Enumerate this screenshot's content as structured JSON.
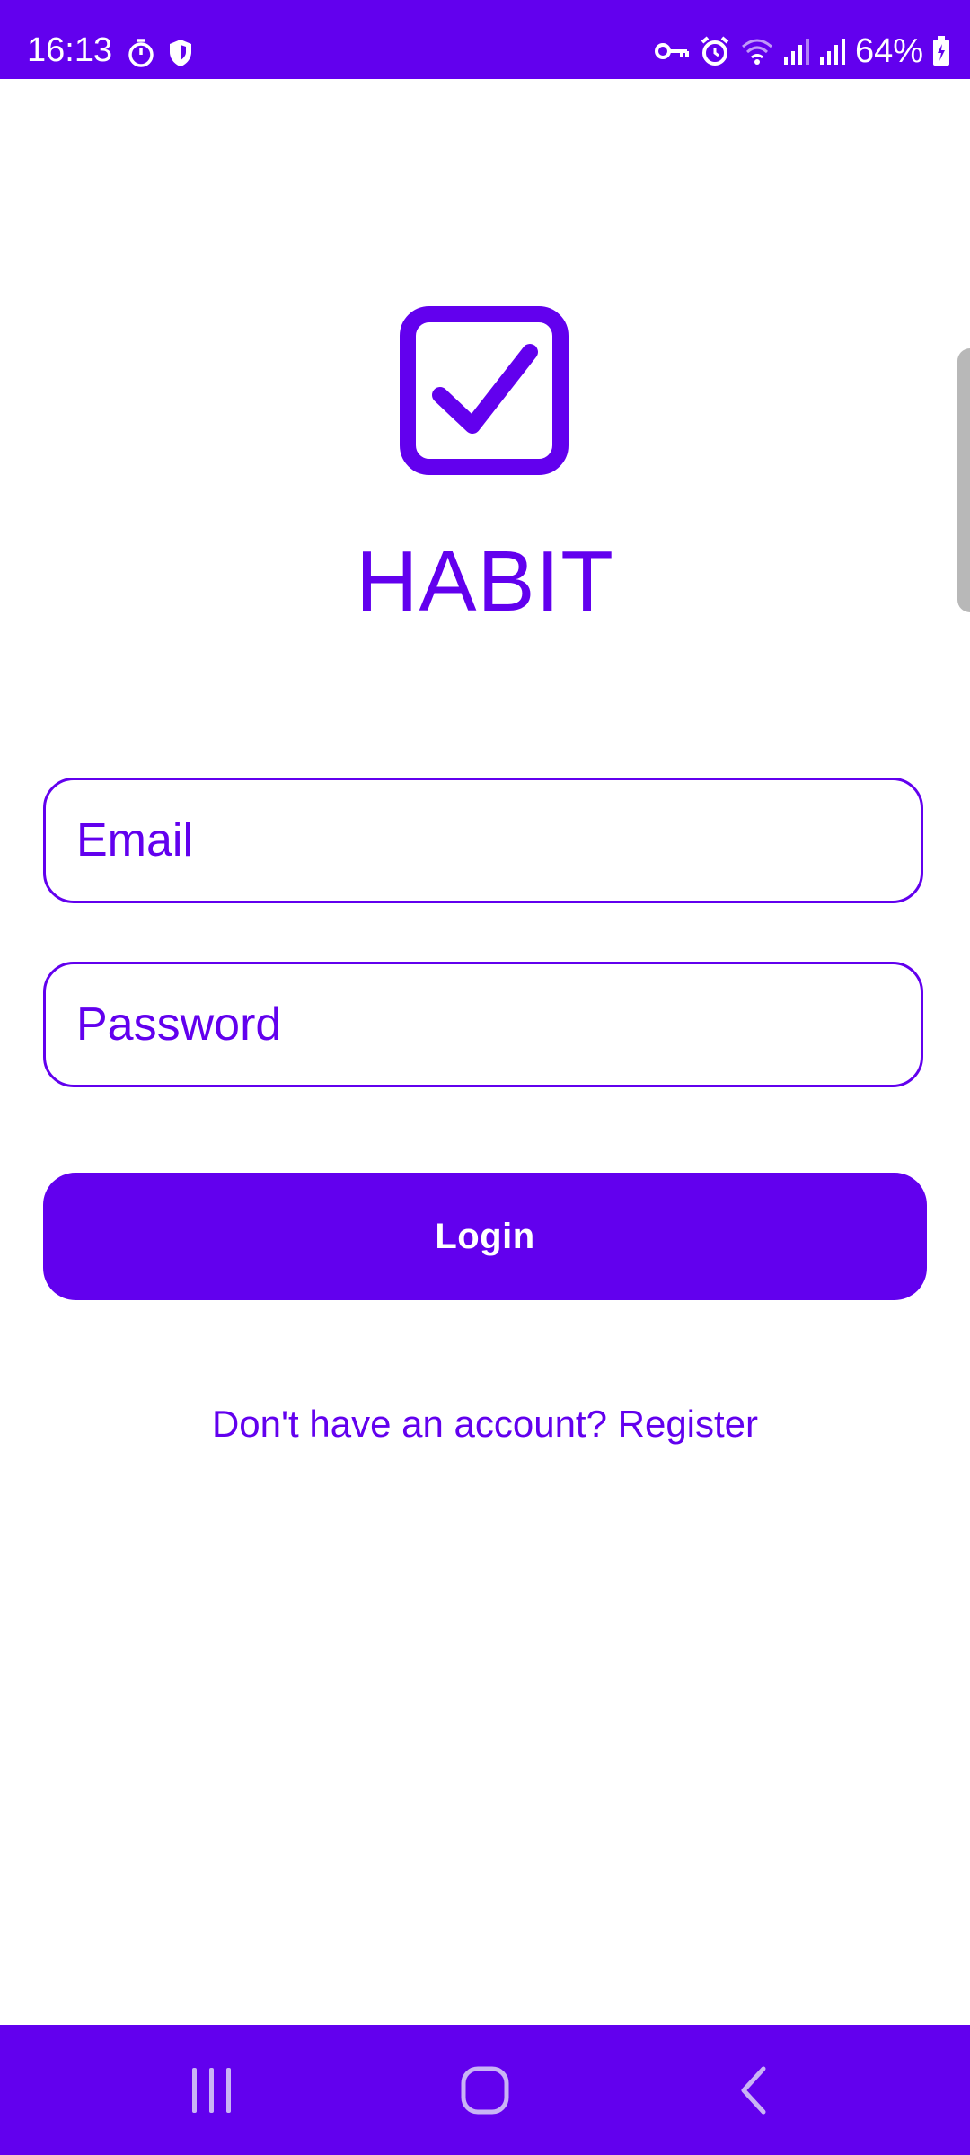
{
  "status_bar": {
    "time": "16:13",
    "battery": "64%",
    "left_icons": [
      "timer-icon",
      "shield-icon"
    ],
    "right_icons": [
      "vpn-key-icon",
      "alarm-icon",
      "wifi-icon",
      "signal-icon",
      "signal-icon",
      "battery-charging-icon"
    ]
  },
  "app": {
    "title": "HABIT",
    "logo_icon": "checkbox-icon"
  },
  "form": {
    "email_placeholder": "Email",
    "email_value": "",
    "password_placeholder": "Password",
    "password_value": "",
    "login_label": "Login",
    "register_text": "Don't have an account? Register"
  },
  "nav_bar": {
    "icons": [
      "recents-icon",
      "home-icon",
      "back-icon"
    ]
  },
  "colors": {
    "accent": "#6200EE",
    "background": "#FFFFFF",
    "on_accent": "#FFFFFF"
  }
}
